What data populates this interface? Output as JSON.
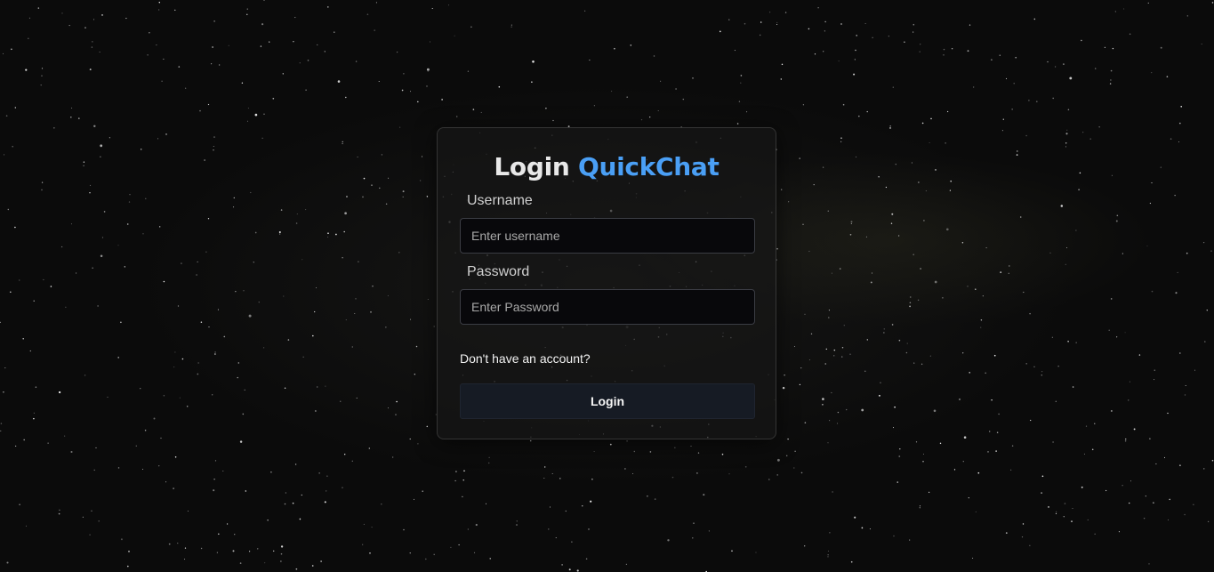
{
  "login": {
    "title_prefix": "Login",
    "title_brand": "QuickChat",
    "username_label": "Username",
    "username_placeholder": "Enter username",
    "username_value": "",
    "password_label": "Password",
    "password_placeholder": "Enter Password",
    "password_value": "",
    "signup_link": "Don't have an account?",
    "submit_label": "Login"
  },
  "colors": {
    "brand_accent": "#4a9ff5",
    "background": "#0b0b0b",
    "button_bg": "#161b24"
  },
  "background": {
    "icon": "starfield-night-sky"
  }
}
